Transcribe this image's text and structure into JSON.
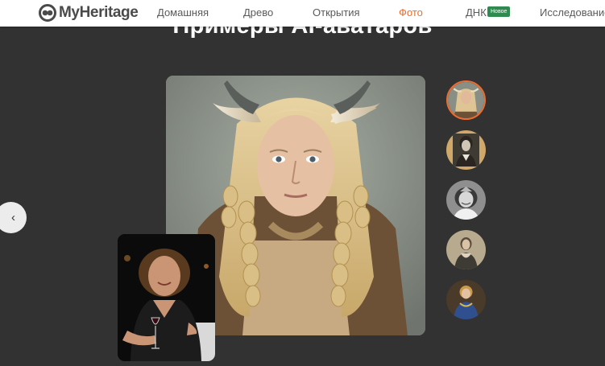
{
  "page": {
    "heading": "Примеры AI-аватаров"
  },
  "nav": {
    "logo_text": "MyHeritage",
    "items": [
      {
        "label": "Домашняя"
      },
      {
        "label": "Древо"
      },
      {
        "label": "Открытия"
      },
      {
        "label": "Фото",
        "active": true
      },
      {
        "label": "ДНК",
        "badge": "Новое"
      },
      {
        "label": "Исследование"
      }
    ],
    "accent_color": "#ef6c2e",
    "badge_color": "#2f8a4f"
  },
  "slider": {
    "prev_icon": "chevron-left-icon",
    "prev_glyph": "‹",
    "main_image": "viking-avatar-portrait",
    "original_photo": "original-photo",
    "thumbnails": [
      {
        "name": "viking-avatar-thumbnail",
        "selected": true
      },
      {
        "name": "victorian-avatar-thumbnail",
        "selected": false
      },
      {
        "name": "bw-portrait-avatar-thumbnail",
        "selected": false
      },
      {
        "name": "renaissance-avatar-thumbnail",
        "selected": false
      },
      {
        "name": "royal-avatar-thumbnail",
        "selected": false
      }
    ]
  }
}
